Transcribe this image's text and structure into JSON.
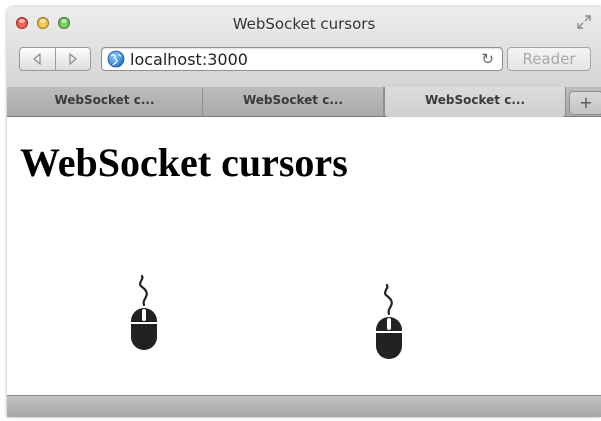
{
  "window": {
    "title": "WebSocket cursors"
  },
  "toolbar": {
    "url": "localhost:3000",
    "reader_label": "Reader",
    "new_tab_label": "+"
  },
  "tabs": [
    {
      "label": "WebSocket c...",
      "active": false
    },
    {
      "label": "WebSocket c...",
      "active": false
    },
    {
      "label": "WebSocket c...",
      "active": true
    }
  ],
  "page": {
    "heading": "WebSocket cursors"
  },
  "icons": {
    "back": "back-arrow-icon",
    "forward": "forward-arrow-icon",
    "site": "globe-icon",
    "reload": "reload-icon",
    "fullscreen": "fullscreen-icon",
    "cursor": "computer-mouse-icon"
  },
  "colors": {
    "close": "#d33a2c",
    "minimize": "#e0a12a",
    "maximize": "#4aa83b",
    "mouse": "#222222"
  }
}
